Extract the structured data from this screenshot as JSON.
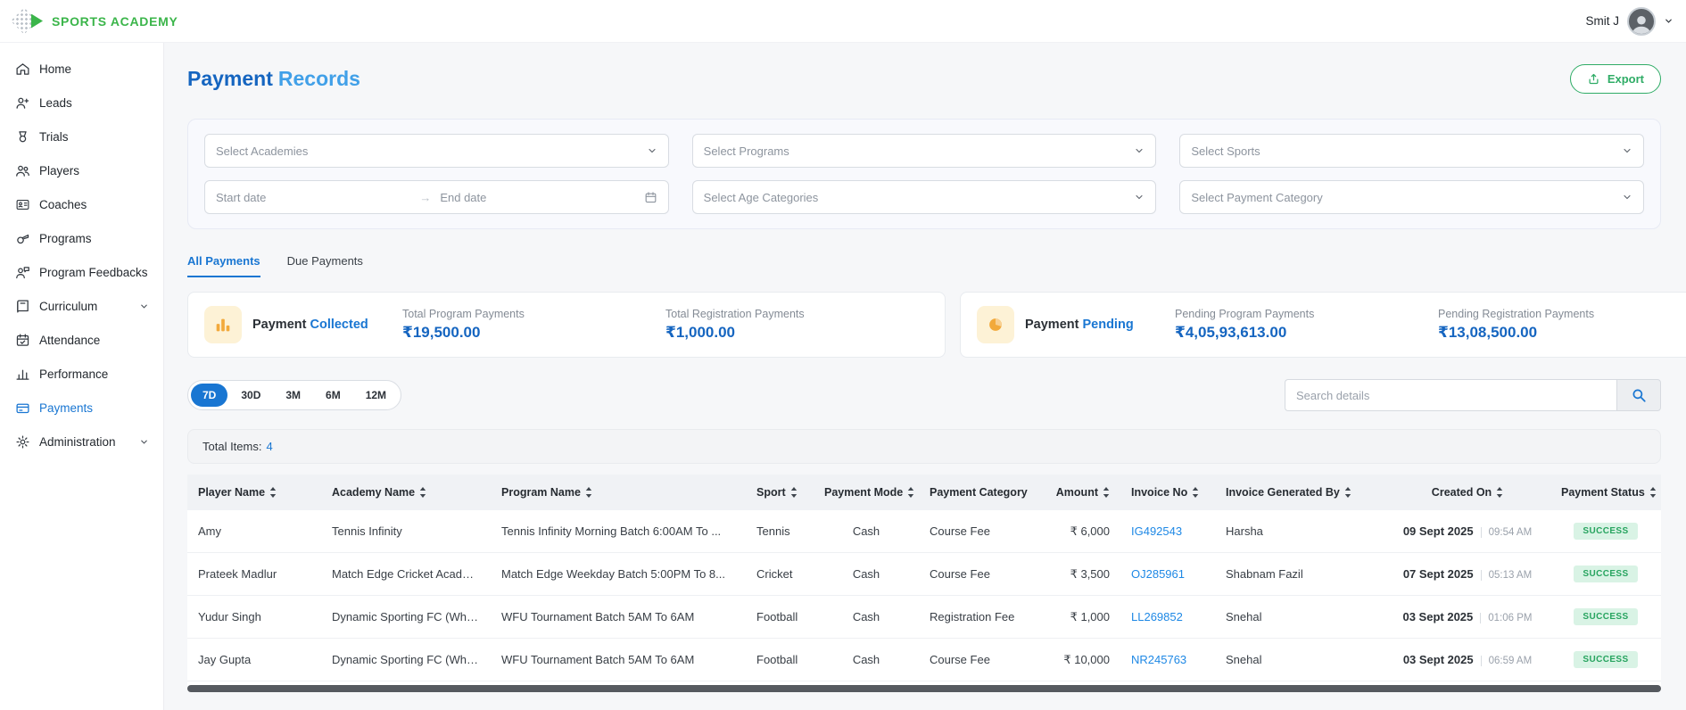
{
  "colors": {
    "brand_green": "#3bb54a",
    "export_green": "#2fac66",
    "primary_blue": "#1976d2",
    "title_dark_blue": "#1565c0",
    "title_light_blue": "#41a0e8",
    "link_blue": "#1e88e5",
    "success_bg": "#d9f3e5",
    "success_text": "#27a45f",
    "summary_icon_amber": "#f2a93b"
  },
  "header": {
    "brand": "SPORTS ACADEMY",
    "user_name": "Smit J"
  },
  "sidebar": {
    "items": [
      {
        "label": "Home"
      },
      {
        "label": "Leads"
      },
      {
        "label": "Trials"
      },
      {
        "label": "Players"
      },
      {
        "label": "Coaches"
      },
      {
        "label": "Programs"
      },
      {
        "label": "Program Feedbacks"
      },
      {
        "label": "Curriculum",
        "expandable": true
      },
      {
        "label": "Attendance"
      },
      {
        "label": "Performance"
      },
      {
        "label": "Payments",
        "active": true
      },
      {
        "label": "Administration",
        "expandable": true
      }
    ]
  },
  "page": {
    "title_primary": "Payment",
    "title_secondary": "Records",
    "export_label": "Export"
  },
  "filters": {
    "academies": "Select Academies",
    "programs": "Select Programs",
    "sports": "Select Sports",
    "start_date": "Start date",
    "date_arrow": "→",
    "end_date": "End date",
    "age_categories": "Select Age Categories",
    "payment_category": "Select Payment Category"
  },
  "tabs": [
    {
      "label": "All Payments",
      "active": true
    },
    {
      "label": "Due Payments",
      "active": false
    }
  ],
  "summary": {
    "collected": {
      "title": "Payment",
      "title_accent": "Collected",
      "metric1_label": "Total Program Payments",
      "metric1_value": "₹19,500.00",
      "metric2_label": "Total Registration Payments",
      "metric2_value": "₹1,000.00"
    },
    "pending": {
      "title": "Payment",
      "title_accent": "Pending",
      "metric1_label": "Pending Program Payments",
      "metric1_value": "₹4,05,93,613.00",
      "metric2_label": "Pending Registration Payments",
      "metric2_value": "₹13,08,500.00"
    }
  },
  "range_filters": [
    "7D",
    "30D",
    "3M",
    "6M",
    "12M"
  ],
  "active_range": "7D",
  "search": {
    "placeholder": "Search details"
  },
  "table": {
    "total_items_label": "Total Items:",
    "total_items_value": "4",
    "columns": [
      {
        "label": "Player Name",
        "sortable": true
      },
      {
        "label": "Academy Name",
        "sortable": true
      },
      {
        "label": "Program Name",
        "sortable": true
      },
      {
        "label": "Sport",
        "sortable": true
      },
      {
        "label": "Payment Mode",
        "sortable": true
      },
      {
        "label": "Payment Category",
        "sortable": false
      },
      {
        "label": "Amount",
        "sortable": true
      },
      {
        "label": "Invoice No",
        "sortable": true
      },
      {
        "label": "Invoice Generated By",
        "sortable": true
      },
      {
        "label": "Created On",
        "sortable": true
      },
      {
        "label": "Payment Status",
        "sortable": true
      }
    ],
    "rows": [
      {
        "player": "Amy",
        "academy": "Tennis Infinity",
        "program": "Tennis Infinity Morning Batch 6:00AM To ...",
        "sport": "Tennis",
        "mode": "Cash",
        "category": "Course Fee",
        "amount": "₹ 6,000",
        "invoice": "IG492543",
        "generated_by": "Harsha",
        "date": "09 Sept 2025",
        "time": "09:54 AM",
        "status": "SUCCESS"
      },
      {
        "player": "Prateek Madlur",
        "academy": "Match Edge Cricket Academy",
        "program": "Match Edge Weekday Batch 5:00PM To 8...",
        "sport": "Cricket",
        "mode": "Cash",
        "category": "Course Fee",
        "amount": "₹ 3,500",
        "invoice": "OJ285961",
        "generated_by": "Shabnam Fazil",
        "date": "07 Sept 2025",
        "time": "05:13 AM",
        "status": "SUCCESS"
      },
      {
        "player": "Yudur Singh",
        "academy": "Dynamic Sporting FC (Whitefield)",
        "program": "WFU Tournament Batch 5AM To 6AM",
        "sport": "Football",
        "mode": "Cash",
        "category": "Registration Fee",
        "amount": "₹ 1,000",
        "invoice": "LL269852",
        "generated_by": "Snehal",
        "date": "03 Sept 2025",
        "time": "01:06 PM",
        "status": "SUCCESS"
      },
      {
        "player": "Jay Gupta",
        "academy": "Dynamic Sporting FC (Whitefield)",
        "program": "WFU Tournament Batch 5AM To 6AM",
        "sport": "Football",
        "mode": "Cash",
        "category": "Course Fee",
        "amount": "₹ 10,000",
        "invoice": "NR245763",
        "generated_by": "Snehal",
        "date": "03 Sept 2025",
        "time": "06:59 AM",
        "status": "SUCCESS"
      }
    ]
  },
  "icons": {
    "export": "upload-arrow",
    "search": "magnifier",
    "calendar": "calendar",
    "collected": "bar-chart",
    "pending": "pie-chart",
    "sort": "up-down-arrows",
    "chevron": "chevron-down"
  }
}
